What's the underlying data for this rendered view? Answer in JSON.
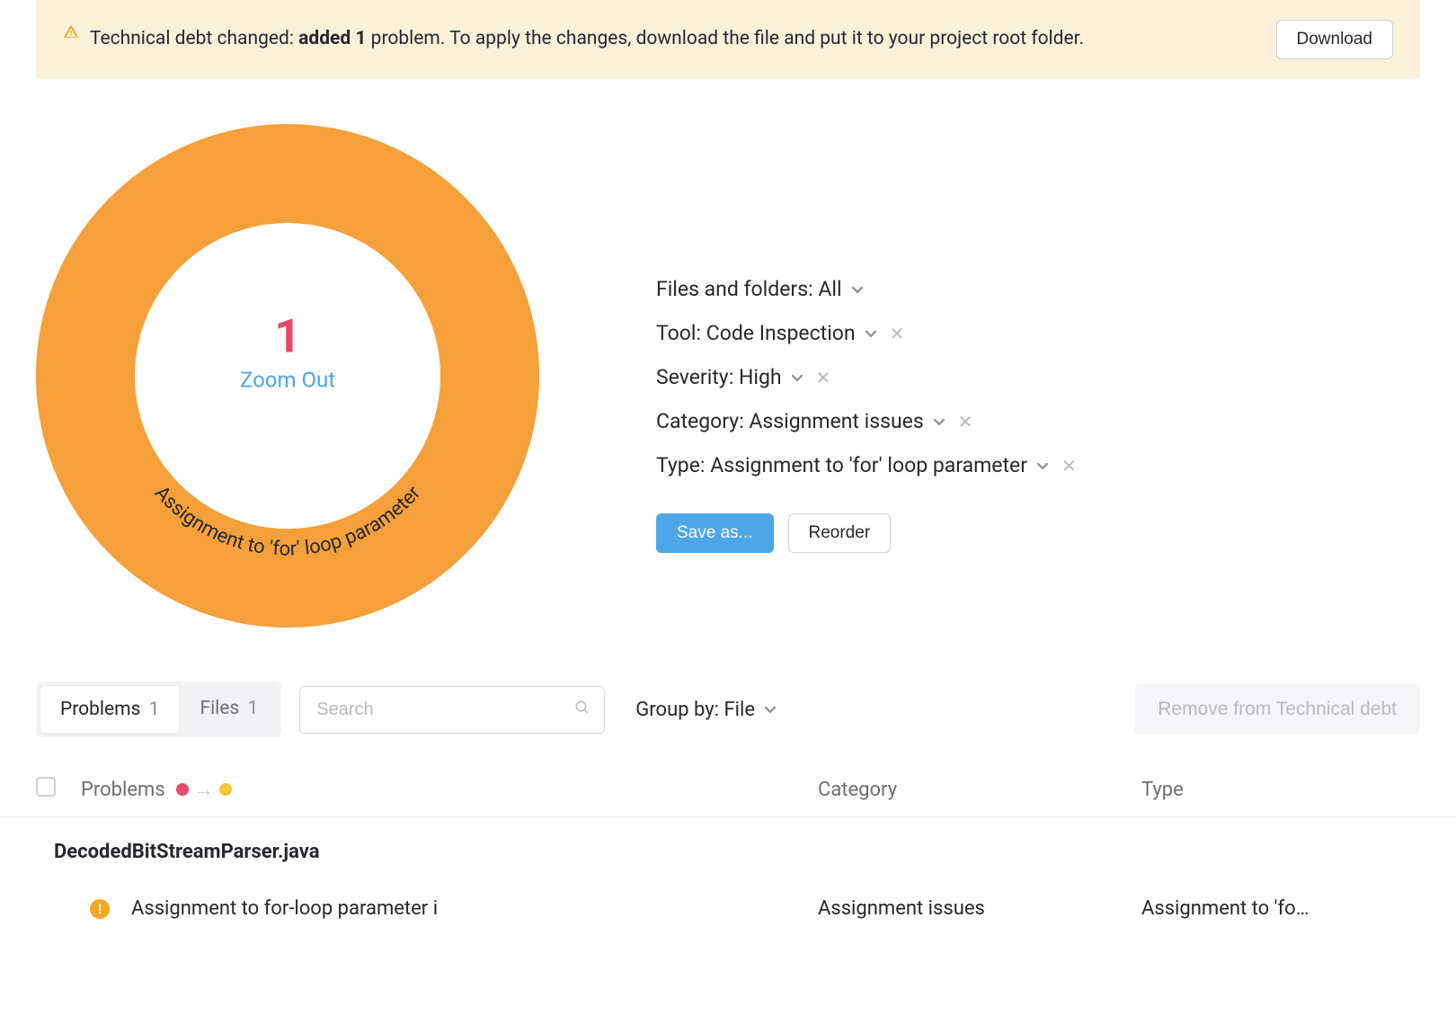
{
  "banner": {
    "prefix": "Technical debt changed: ",
    "bold": "added 1",
    "suffix": " problem. To apply the changes, download the file and put it to your project root folder.",
    "download": "Download"
  },
  "chart_data": {
    "type": "pie",
    "title": "",
    "series": [
      {
        "name": "Assignment to 'for' loop parameter",
        "value": 1,
        "color": "#f5a03a"
      }
    ],
    "total_label": "1",
    "center_action": "Zoom Out"
  },
  "filters": {
    "items": [
      {
        "label": "Files and folders:",
        "value": "All",
        "removable": false
      },
      {
        "label": "Tool:",
        "value": "Code Inspection",
        "removable": true
      },
      {
        "label": "Severity:",
        "value": "High",
        "removable": true
      },
      {
        "label": "Category:",
        "value": "Assignment issues",
        "removable": true
      },
      {
        "label": "Type:",
        "value": "Assignment to 'for' loop parameter",
        "removable": true
      }
    ],
    "save_as": "Save as...",
    "reorder": "Reorder"
  },
  "toolbar": {
    "tabs": [
      {
        "label": "Problems",
        "count": "1",
        "active": true
      },
      {
        "label": "Files",
        "count": "1",
        "active": false
      }
    ],
    "search_placeholder": "Search",
    "group_by_label": "Group by:",
    "group_by_value": "File",
    "remove_label": "Remove from Technical debt"
  },
  "table": {
    "headers": {
      "problems": "Problems",
      "category": "Category",
      "type": "Type"
    },
    "groups": [
      {
        "file": "DecodedBitStreamParser.java",
        "rows": [
          {
            "name": "Assignment to for-loop parameter i",
            "category": "Assignment issues",
            "type": "Assignment to 'fo…"
          }
        ]
      }
    ]
  }
}
